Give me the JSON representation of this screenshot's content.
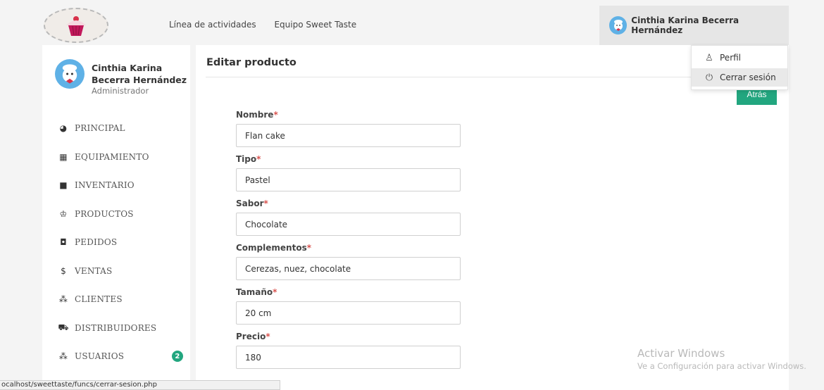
{
  "navbar": {
    "links": [
      "Línea de actividades",
      "Equipo Sweet Taste"
    ],
    "user_name": "Cinthia Karina Becerra Hernández"
  },
  "dropdown": {
    "items": [
      {
        "label": "Perfil",
        "icon": "user-icon"
      },
      {
        "label": "Cerrar sesión",
        "icon": "power-icon"
      }
    ]
  },
  "sidebar": {
    "profile": {
      "name": "Cinthia Karina Becerra Hernández",
      "role": "Administrador"
    },
    "items": [
      {
        "label": "PRINCIPAL",
        "icon": "dashboard-icon"
      },
      {
        "label": "EQUIPAMIENTO",
        "icon": "calendar-icon"
      },
      {
        "label": "INVENTARIO",
        "icon": "box-icon"
      },
      {
        "label": "PRODUCTOS",
        "icon": "cake-icon"
      },
      {
        "label": "PEDIDOS",
        "icon": "bag-icon"
      },
      {
        "label": "VENTAS",
        "icon": "dollar-icon"
      },
      {
        "label": "CLIENTES",
        "icon": "users-icon"
      },
      {
        "label": "DISTRIBUIDORES",
        "icon": "truck-icon"
      },
      {
        "label": "USUARIOS",
        "icon": "users-icon",
        "badge": "2"
      }
    ]
  },
  "main": {
    "title": "Editar producto",
    "back_label": "Atrás",
    "fields": [
      {
        "label": "Nombre",
        "required": "*",
        "value": "Flan cake"
      },
      {
        "label": "Tipo",
        "required": "*",
        "value": "Pastel"
      },
      {
        "label": "Sabor",
        "required": "*",
        "value": "Chocolate"
      },
      {
        "label": "Complementos",
        "required": "*",
        "value": "Cerezas, nuez, chocolate"
      },
      {
        "label": "Tamaño",
        "required": "*",
        "value": "20 cm"
      },
      {
        "label": "Precio",
        "required": "*",
        "value": "180"
      }
    ]
  },
  "watermark": {
    "line1": "Activar Windows",
    "line2": "Ve a Configuración para activar Windows."
  },
  "statusbar": {
    "url": "ocalhost/sweettaste/funcs/cerrar-sesion.php"
  },
  "colors": {
    "accent": "#22a67f",
    "required": "#d9534f",
    "avatar": "#5fb1e6"
  }
}
